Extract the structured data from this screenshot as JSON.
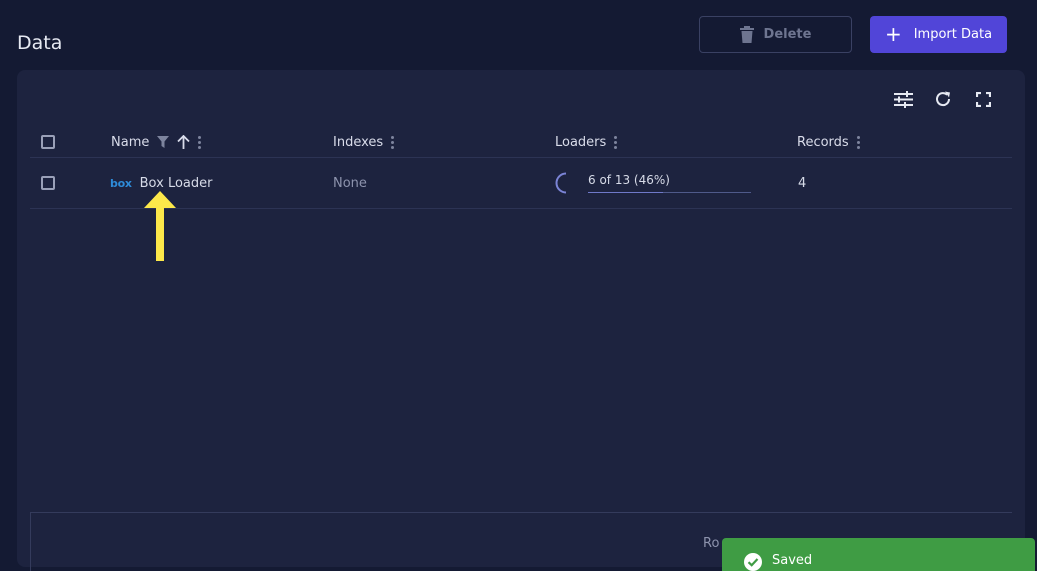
{
  "page": {
    "title": "Data"
  },
  "toolbar": {
    "delete_label": "Delete",
    "import_label": "Import Data"
  },
  "table": {
    "columns": [
      "Name",
      "Indexes",
      "Loaders",
      "Records"
    ],
    "rows": [
      {
        "logo_text": "box",
        "name": "Box Loader",
        "indexes": "None",
        "loaders_text": "6 of 13 (46%)",
        "loaders_progress": 0.46,
        "records": "4"
      }
    ]
  },
  "footer": {
    "rows_label": "Ro"
  },
  "toast": {
    "message": "Saved"
  },
  "colors": {
    "background": "#141a33",
    "card": "#1d233f",
    "accent": "#5145d8",
    "success": "#3f9c44",
    "annotation_arrow": "#fde84a"
  }
}
